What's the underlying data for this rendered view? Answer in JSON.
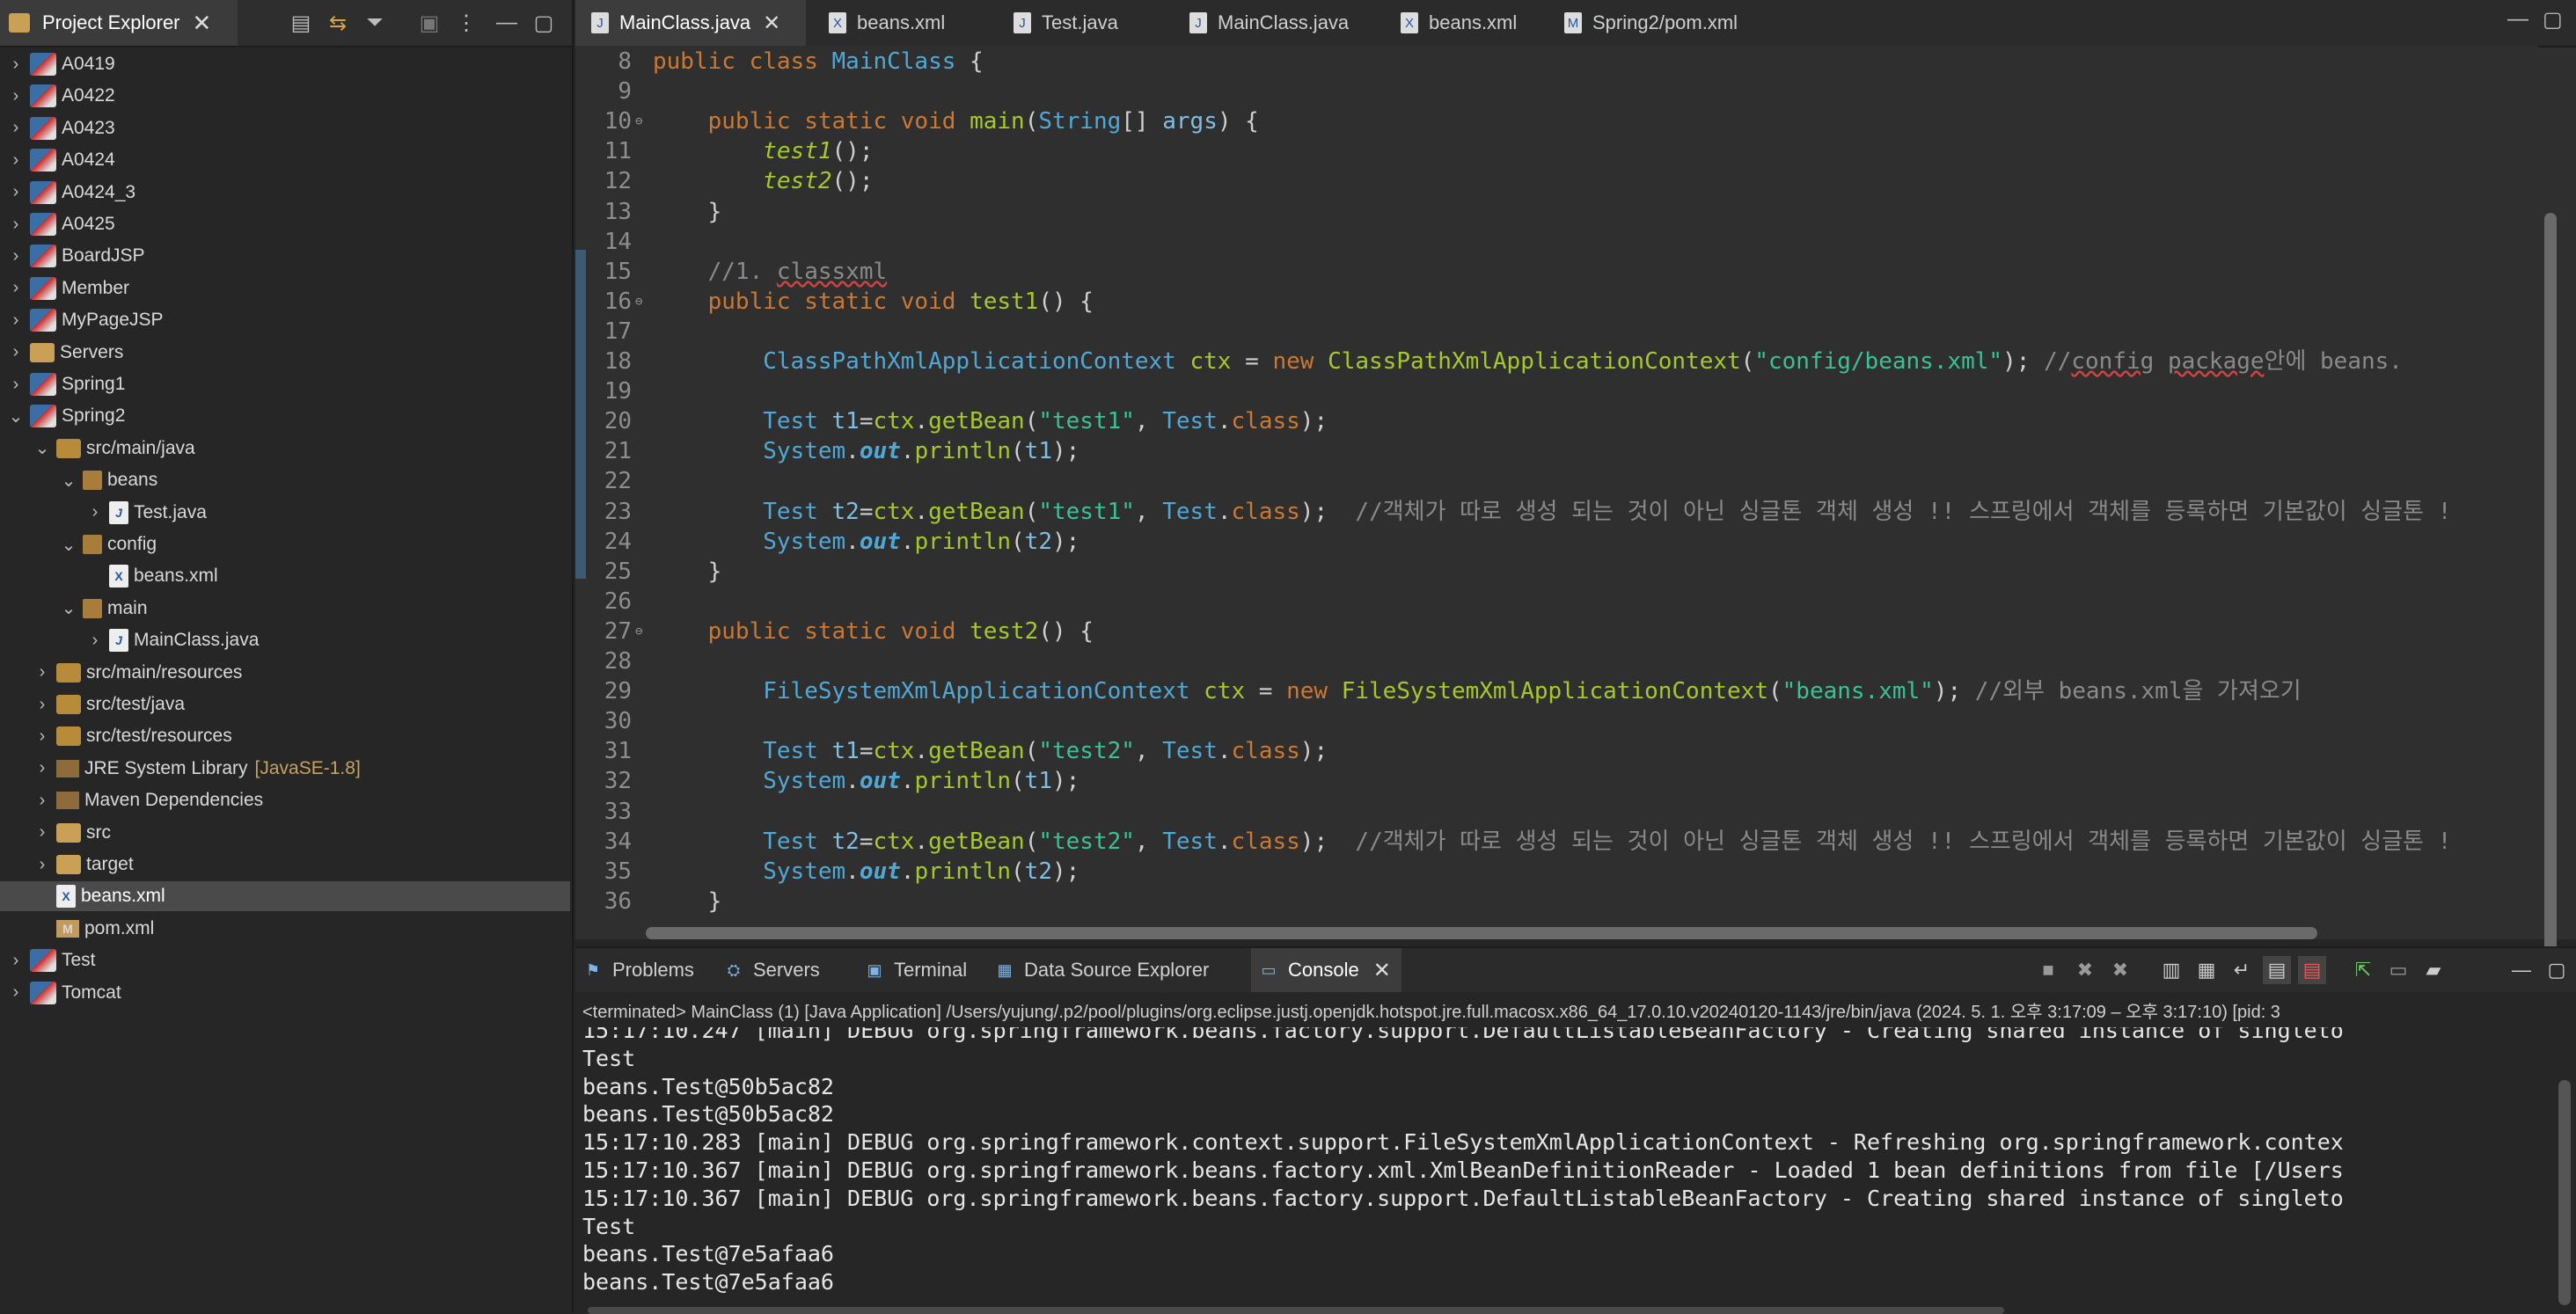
{
  "explorer": {
    "title": "Project Explorer",
    "items": [
      {
        "label": "A0419",
        "expanded": false,
        "icon": "project-icon"
      },
      {
        "label": "A0422",
        "expanded": false,
        "icon": "project-icon"
      },
      {
        "label": "A0423",
        "expanded": false,
        "icon": "project-icon"
      },
      {
        "label": "A0424",
        "expanded": false,
        "icon": "project-icon"
      },
      {
        "label": "A0424_3",
        "expanded": false,
        "icon": "project-icon"
      },
      {
        "label": "A0425",
        "expanded": false,
        "icon": "project-icon"
      },
      {
        "label": "BoardJSP",
        "expanded": false,
        "icon": "project-icon"
      },
      {
        "label": "Member",
        "expanded": false,
        "icon": "project-icon"
      },
      {
        "label": "MyPageJSP",
        "expanded": false,
        "icon": "project-icon"
      },
      {
        "label": "Servers",
        "expanded": false,
        "icon": "folder-icon"
      },
      {
        "label": "Spring1",
        "expanded": false,
        "icon": "project-icon"
      },
      {
        "label": "Spring2",
        "expanded": true,
        "icon": "project-icon"
      },
      {
        "label": "src/main/java",
        "expanded": true,
        "icon": "source-folder-icon"
      },
      {
        "label": "beans",
        "expanded": true,
        "icon": "package-icon"
      },
      {
        "label": "Test.java",
        "expanded": false,
        "icon": "java-file-icon"
      },
      {
        "label": "config",
        "expanded": true,
        "icon": "package-icon"
      },
      {
        "label": "beans.xml",
        "icon": "xml-file-icon"
      },
      {
        "label": "main",
        "expanded": true,
        "icon": "package-icon"
      },
      {
        "label": "MainClass.java",
        "expanded": false,
        "icon": "java-file-icon"
      },
      {
        "label": "src/main/resources",
        "expanded": false,
        "icon": "source-folder-icon"
      },
      {
        "label": "src/test/java",
        "expanded": false,
        "icon": "source-folder-icon"
      },
      {
        "label": "src/test/resources",
        "expanded": false,
        "icon": "source-folder-icon"
      },
      {
        "label": "JRE System Library",
        "suffix": "[JavaSE-1.8]",
        "expanded": false,
        "icon": "library-icon"
      },
      {
        "label": "Maven Dependencies",
        "expanded": false,
        "icon": "library-icon"
      },
      {
        "label": "src",
        "expanded": false,
        "icon": "folder-icon"
      },
      {
        "label": "target",
        "expanded": false,
        "icon": "folder-icon"
      },
      {
        "label": "beans.xml",
        "selected": true,
        "icon": "xml-file-icon"
      },
      {
        "label": "pom.xml",
        "icon": "maven-file-icon"
      },
      {
        "label": "Test",
        "expanded": false,
        "icon": "project-icon"
      },
      {
        "label": "Tomcat",
        "expanded": false,
        "icon": "project-icon"
      }
    ]
  },
  "editor": {
    "tabs": [
      {
        "label": "MainClass.java",
        "active": true,
        "closable": true,
        "icon": "java-file-icon"
      },
      {
        "label": "beans.xml",
        "icon": "xml-file-icon"
      },
      {
        "label": "Test.java",
        "icon": "java-file-icon"
      },
      {
        "label": "MainClass.java",
        "icon": "java-file-icon"
      },
      {
        "label": "beans.xml",
        "icon": "xml-file-icon"
      },
      {
        "label": "Spring2/pom.xml",
        "icon": "maven-file-icon"
      }
    ],
    "lines": [
      {
        "n": "8",
        "html": "<span class='kw'>public</span> <span class='kw'>class</span> <span class='cls'>MainClass</span> {"
      },
      {
        "n": "9",
        "html": ""
      },
      {
        "n": "10",
        "fold": true,
        "html": "    <span class='kw'>public</span> <span class='kw'>static</span> <span class='kw'>void</span> <span class='mth'>main</span>(<span class='cls'>String</span>[] <span class='param'>args</span>) {"
      },
      {
        "n": "11",
        "html": "        <span class='imth'>test1</span>();"
      },
      {
        "n": "12",
        "html": "        <span class='imth'>test2</span>();"
      },
      {
        "n": "13",
        "html": "    }"
      },
      {
        "n": "14",
        "html": ""
      },
      {
        "n": "15",
        "html": "    <span class='cmt'>//1. <span class='sq'>classxml</span></span>"
      },
      {
        "n": "16",
        "fold": true,
        "html": "    <span class='kw'>public</span> <span class='kw'>static</span> <span class='kw'>void</span> <span class='mth'>test1</span>() {"
      },
      {
        "n": "17",
        "html": ""
      },
      {
        "n": "18",
        "html": "        <span class='cls'>ClassPathXmlApplicationContext</span> <span class='mth'>ctx</span> = <span class='kw'>new</span> <span class='mth'>ClassPathXmlApplicationContext</span>(<span class='str'>\"config/beans.xml\"</span>); <span class='cmt'>//<span class='sq'>config</span> <span class='sq'>package</span>안에 beans.</span>"
      },
      {
        "n": "19",
        "html": ""
      },
      {
        "n": "20",
        "html": "        <span class='cls'>Test</span> <span class='param'>t1</span>=<span class='mth'>ctx</span>.<span class='mth'>getBean</span>(<span class='str'>\"test1\"</span>, <span class='cls'>Test</span>.<span class='kw'>class</span>);"
      },
      {
        "n": "21",
        "html": "        <span class='cls'>System</span>.<span class='fld'>out</span>.<span class='mth'>println</span>(<span class='param'>t1</span>);"
      },
      {
        "n": "22",
        "html": ""
      },
      {
        "n": "23",
        "html": "        <span class='cls'>Test</span> <span class='param'>t2</span>=<span class='mth'>ctx</span>.<span class='mth'>getBean</span>(<span class='str'>\"test1\"</span>, <span class='cls'>Test</span>.<span class='kw'>class</span>);  <span class='cmt'>//객체가 따로 생성 되는 것이 아닌 싱글톤 객체 생성 !! 스프링에서 객체를 등록하면 기본값이 싱글톤 !</span>"
      },
      {
        "n": "24",
        "html": "        <span class='cls'>System</span>.<span class='fld'>out</span>.<span class='mth'>println</span>(<span class='param'>t2</span>);"
      },
      {
        "n": "25",
        "html": "    }"
      },
      {
        "n": "26",
        "html": ""
      },
      {
        "n": "27",
        "fold": true,
        "html": "    <span class='kw'>public</span> <span class='kw'>static</span> <span class='kw'>void</span> <span class='mth'>test2</span>() {"
      },
      {
        "n": "28",
        "html": ""
      },
      {
        "n": "29",
        "html": "        <span class='cls'>FileSystemXmlApplicationContext</span> <span class='mth'>ctx</span> = <span class='kw'>new</span> <span class='mth'>FileSystemXmlApplicationContext</span>(<span class='str'>\"beans.xml\"</span>); <span class='cmt'>//외부 beans.xml을 가져오기</span>"
      },
      {
        "n": "30",
        "html": ""
      },
      {
        "n": "31",
        "html": "        <span class='cls'>Test</span> <span class='param'>t1</span>=<span class='mth'>ctx</span>.<span class='mth'>getBean</span>(<span class='str'>\"test2\"</span>, <span class='cls'>Test</span>.<span class='kw'>class</span>);"
      },
      {
        "n": "32",
        "html": "        <span class='cls'>System</span>.<span class='fld'>out</span>.<span class='mth'>println</span>(<span class='param'>t1</span>);"
      },
      {
        "n": "33",
        "html": ""
      },
      {
        "n": "34",
        "html": "        <span class='cls'>Test</span> <span class='param'>t2</span>=<span class='mth'>ctx</span>.<span class='mth'>getBean</span>(<span class='str'>\"test2\"</span>, <span class='cls'>Test</span>.<span class='kw'>class</span>);  <span class='cmt'>//객체가 따로 생성 되는 것이 아닌 싱글톤 객체 생성 !! 스프링에서 객체를 등록하면 기본값이 싱글톤 !</span>"
      },
      {
        "n": "35",
        "html": "        <span class='cls'>System</span>.<span class='fld'>out</span>.<span class='mth'>println</span>(<span class='param'>t2</span>);"
      },
      {
        "n": "36",
        "html": "    }"
      }
    ]
  },
  "bottom": {
    "tabs": [
      {
        "label": "Problems",
        "icon": "problems-icon"
      },
      {
        "label": "Servers",
        "icon": "servers-icon"
      },
      {
        "label": "Terminal",
        "icon": "terminal-icon"
      },
      {
        "label": "Data Source Explorer",
        "icon": "datasource-icon"
      },
      {
        "label": "Console",
        "icon": "console-icon",
        "active": true,
        "closable": true
      }
    ],
    "status": "<terminated> MainClass (1) [Java Application] /Users/yujung/.p2/pool/plugins/org.eclipse.justj.openjdk.hotspot.jre.full.macosx.x86_64_17.0.10.v20240120-1143/jre/bin/java  (2024. 5. 1. 오후 3:17:09 – 오후 3:17:10) [pid: 3",
    "lines": [
      "15:17:10.247 [main] DEBUG org.springframework.beans.factory.support.DefaultListableBeanFactory - Creating shared instance of singleto",
      "Test",
      "beans.Test@50b5ac82",
      "beans.Test@50b5ac82",
      "15:17:10.283 [main] DEBUG org.springframework.context.support.FileSystemXmlApplicationContext - Refreshing org.springframework.contex",
      "15:17:10.367 [main] DEBUG org.springframework.beans.factory.xml.XmlBeanDefinitionReader - Loaded 1 bean definitions from file [/Users",
      "15:17:10.367 [main] DEBUG org.springframework.beans.factory.support.DefaultListableBeanFactory - Creating shared instance of singleto",
      "Test",
      "beans.Test@7e5afaa6",
      "beans.Test@7e5afaa6"
    ]
  },
  "glyphs": {
    "close": "✕",
    "chevron_right": "›",
    "chevron_down": "⌄",
    "minimize": "—",
    "maximize": "▢",
    "fold": "⊖"
  }
}
